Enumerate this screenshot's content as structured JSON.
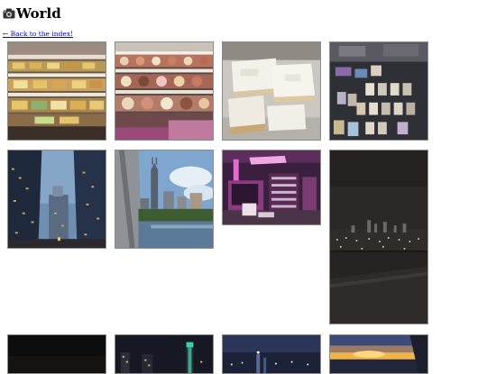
{
  "page": {
    "title": "World",
    "title_icon": "camera-icon",
    "back_link": "← Back to the index!"
  },
  "gallery": {
    "photos": [
      {
        "name": "photo-bakery-case-1",
        "subject": "bakery display case with pastries"
      },
      {
        "name": "photo-bakery-case-2",
        "subject": "bakery display case with cakes"
      },
      {
        "name": "photo-sheet-cake",
        "subject": "frosted sheet cake slices"
      },
      {
        "name": "photo-card-game",
        "subject": "trading card game on a table"
      },
      {
        "name": "photo-skyscrapers",
        "subject": "city skyscrapers at dusk"
      },
      {
        "name": "photo-nashville-skyline",
        "subject": "city skyline seen from a bridge"
      },
      {
        "name": "photo-neon-room",
        "subject": "room lit with pink and purple neon"
      },
      {
        "name": "photo-night-window",
        "subject": "night city lights from a train window"
      },
      {
        "name": "photo-dark-sky",
        "subject": "dark night sky"
      },
      {
        "name": "photo-night-skyline",
        "subject": "night skyline with lit tower"
      },
      {
        "name": "photo-night-bridge",
        "subject": "city lights along a river at night"
      },
      {
        "name": "photo-sunset-window",
        "subject": "sunset seen from an airplane window"
      }
    ]
  }
}
